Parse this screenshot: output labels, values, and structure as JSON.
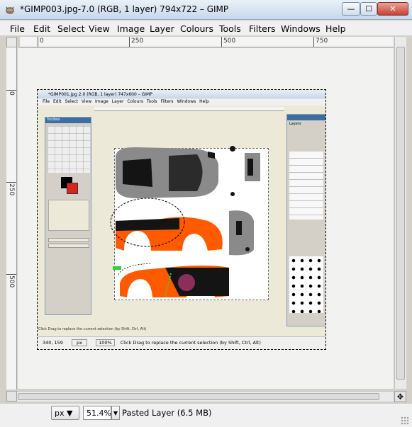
{
  "window": {
    "title": "*GIMP003.jpg-7.0 (RGB, 1 layer) 794x722 – GIMP",
    "min_label": "—",
    "max_label": "☐",
    "close_label": "✕"
  },
  "menu": [
    "File",
    "Edit",
    "Select",
    "View",
    "Image",
    "Layer",
    "Colours",
    "Tools",
    "Filters",
    "Windows",
    "Help"
  ],
  "hruler": [
    "0",
    "250",
    "500",
    "750"
  ],
  "vruler": [
    "0",
    "250",
    "500"
  ],
  "inner": {
    "title": "*GIMP001.jpg 2.0 (RGB, 1 layer) 747x600 – GIMP",
    "menu": "File Edit Select View Image Layer Colours Tools Filters Windows Help",
    "toolbox_title": "Toolbox",
    "layers_title": "Layers",
    "status": "Click Drag to replace the current selection (by Shift, Ctrl, Alt)",
    "coords": "340, 159",
    "unit": "px",
    "zoom": "100%",
    "hint": "Click Drag to replace the current selection (by Shift, Ctrl, Alt)"
  },
  "status": {
    "unit": "px",
    "zoom": "51.4%",
    "message": "Pasted Layer (6.5 MB)"
  },
  "colors": {
    "orange": "#ff5a00",
    "grey_car": "#8a8a8a",
    "dark": "#141414",
    "green": "#2ed13a",
    "accent": "#3a6ea5"
  }
}
